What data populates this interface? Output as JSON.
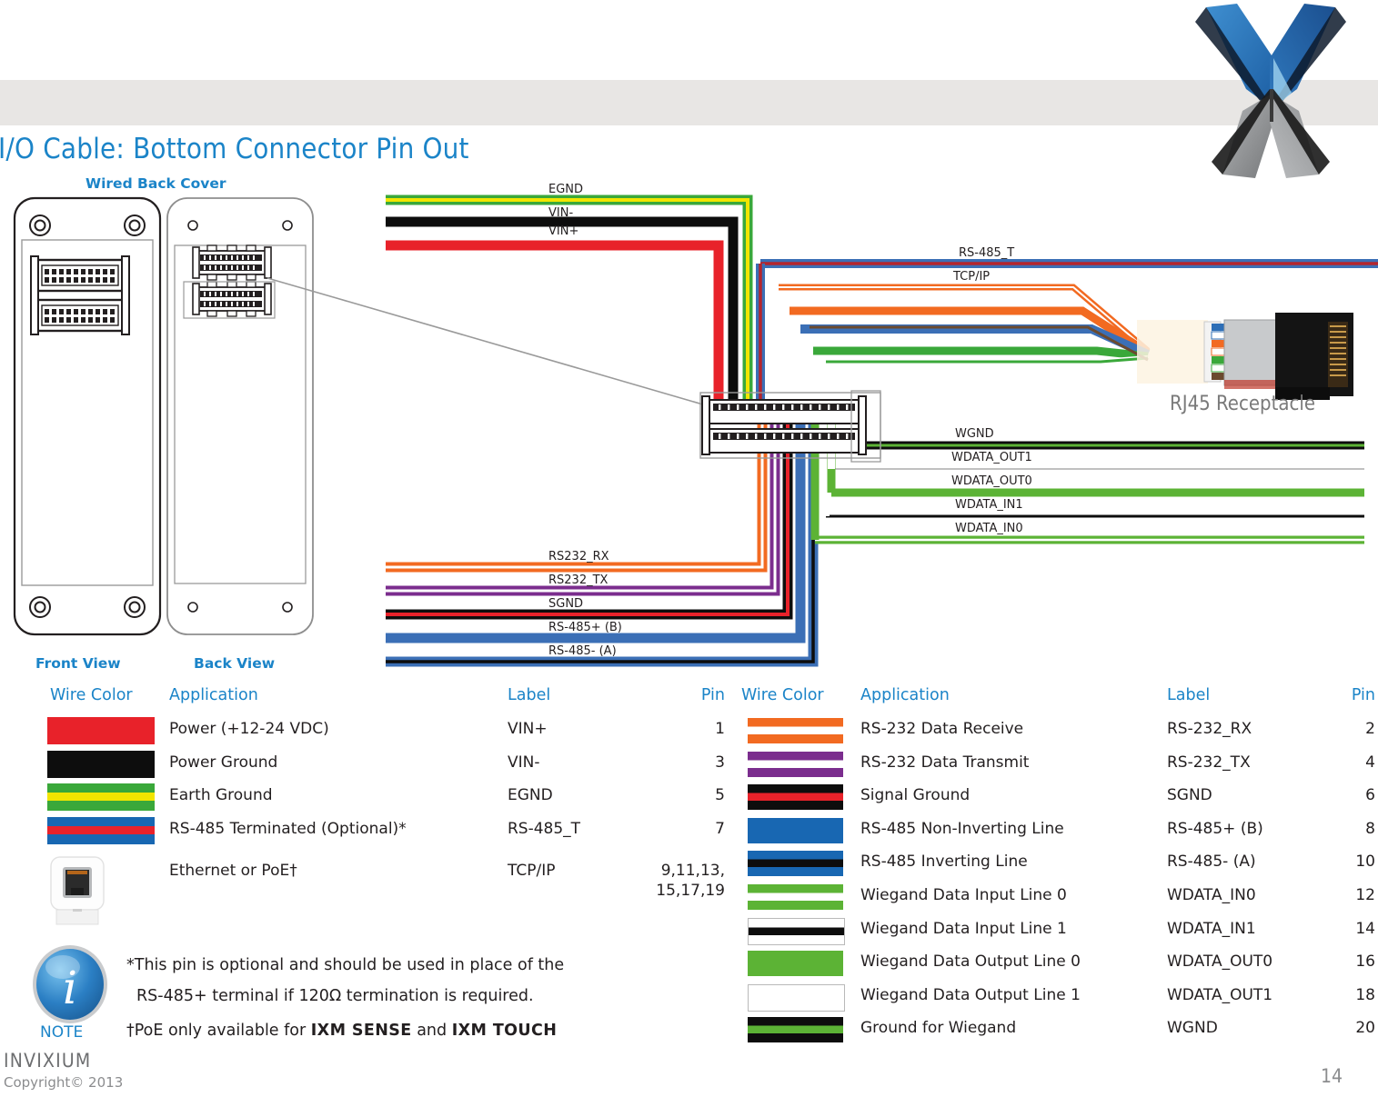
{
  "page": {
    "title": "I/O Cable: Bottom Connector Pin Out",
    "brand": "INVIXIUM",
    "copyright": "Copyright© 2013",
    "page_number": "14",
    "logo_icon": "invixium-x-logo",
    "accent_color": "#1b84c8",
    "header_band_color": "#e8e6e4"
  },
  "diagram": {
    "section_label": "Wired Back Cover",
    "front_view_label": "Front View",
    "back_view_label": "Back View",
    "rj45_label": "RJ45 Receptacle",
    "left_wire_labels": [
      "EGND",
      "VIN-",
      "VIN+",
      "RS232_RX",
      "RS232_TX",
      "SGND",
      "RS-485+ (B)",
      "RS-485- (A)"
    ],
    "right_wire_labels": [
      "RS-485_T",
      "TCP/IP",
      "WGND",
      "WDATA_OUT1",
      "WDATA_OUT0",
      "WDATA_IN1",
      "WDATA_IN0"
    ]
  },
  "table_left": {
    "headers": {
      "wire_color": "Wire Color",
      "application": "Application",
      "label": "Label",
      "pin": "Pin"
    },
    "rows": [
      {
        "application": "Power (+12-24 VDC)",
        "label": "VIN+",
        "pin": "1",
        "swatch": "solid",
        "colors": [
          "#e8222a"
        ]
      },
      {
        "application": "Power Ground",
        "label": "VIN-",
        "pin": "3",
        "swatch": "solid",
        "colors": [
          "#0d0d0d"
        ]
      },
      {
        "application": "Earth Ground",
        "label": "EGND",
        "pin": "5",
        "swatch": "stripe3",
        "colors": [
          "#3aa83a",
          "#f2e500",
          "#3aa83a"
        ]
      },
      {
        "application": "RS-485 Terminated (Optional)*",
        "label": "RS-485_T",
        "pin": "7",
        "swatch": "stripe3",
        "colors": [
          "#1867b2",
          "#e8222a",
          "#1867b2"
        ]
      },
      {
        "application": "Ethernet or PoE†",
        "label": "TCP/IP",
        "pin": "9,11,13,\n15,17,19",
        "swatch": "rj45-icon",
        "colors": []
      }
    ]
  },
  "table_right": {
    "headers": {
      "wire_color": "Wire Color",
      "application": "Application",
      "label": "Label",
      "pin": "Pin"
    },
    "rows": [
      {
        "application": "RS-232 Data Receive",
        "label": "RS-232_RX",
        "pin": "2",
        "swatch": "stripe3",
        "colors": [
          "#f26a21",
          "#ffffff",
          "#f26a21"
        ]
      },
      {
        "application": "RS-232 Data Transmit",
        "label": "RS-232_TX",
        "pin": "4",
        "swatch": "stripe3",
        "colors": [
          "#7b2d8e",
          "#ffffff",
          "#7b2d8e"
        ]
      },
      {
        "application": "Signal Ground",
        "label": "SGND",
        "pin": "6",
        "swatch": "stripe3",
        "colors": [
          "#0d0d0d",
          "#e8222a",
          "#0d0d0d"
        ]
      },
      {
        "application": "RS-485 Non-Inverting Line",
        "label": "RS-485+ (B)",
        "pin": "8",
        "swatch": "solid",
        "colors": [
          "#1867b2"
        ]
      },
      {
        "application": "RS-485 Inverting Line",
        "label": "RS-485- (A)",
        "pin": "10",
        "swatch": "stripe3",
        "colors": [
          "#1867b2",
          "#0d0d0d",
          "#1867b2"
        ]
      },
      {
        "application": "Wiegand Data Input Line 0",
        "label": "WDATA_IN0",
        "pin": "12",
        "swatch": "stripe3",
        "colors": [
          "#5cb335",
          "#ffffff",
          "#5cb335"
        ]
      },
      {
        "application": "Wiegand Data Input Line 1",
        "label": "WDATA_IN1",
        "pin": "14",
        "swatch": "stripe3",
        "colors": [
          "#ffffff",
          "#0d0d0d",
          "#ffffff"
        ]
      },
      {
        "application": "Wiegand Data Output Line 0",
        "label": "WDATA_OUT0",
        "pin": "16",
        "swatch": "solid",
        "colors": [
          "#5cb335"
        ]
      },
      {
        "application": "Wiegand Data Output Line 1",
        "label": "WDATA_OUT1",
        "pin": "18",
        "swatch": "solid",
        "colors": [
          "#ffffff"
        ]
      },
      {
        "application": "Ground for Wiegand",
        "label": "WGND",
        "pin": "20",
        "swatch": "stripe3",
        "colors": [
          "#0d0d0d",
          "#5cb335",
          "#0d0d0d"
        ]
      }
    ]
  },
  "note": {
    "icon": "info-icon",
    "word": "NOTE",
    "line1": "*This pin is optional and should be used in place of the",
    "line2": "RS-485+ terminal if 120Ω termination is required.",
    "line3_prefix": "†PoE only available for ",
    "line3_prod1": "IXM SENSE",
    "line3_mid": " and ",
    "line3_prod2": "IXM TOUCH"
  }
}
